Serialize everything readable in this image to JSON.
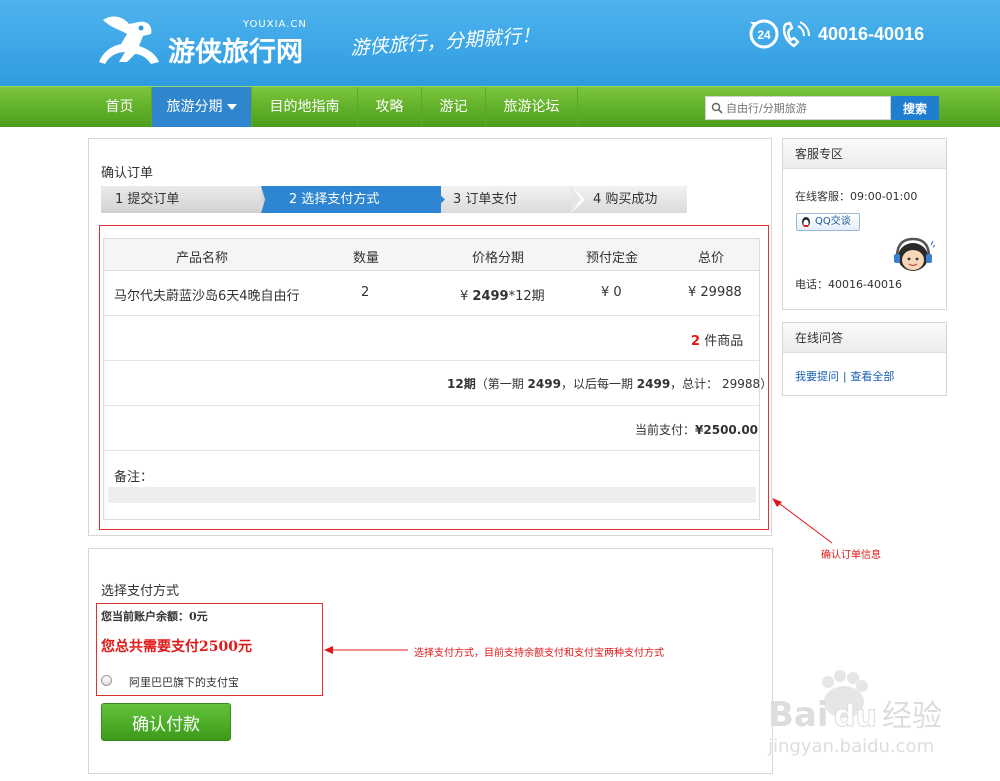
{
  "header": {
    "logo_small": "YOUXIA.CN",
    "logo_main": "游侠旅行网",
    "slogan": "游侠旅行，分期就行！",
    "phone_badge": "24",
    "phone": "40016-40016"
  },
  "nav": {
    "items": [
      {
        "label": "首页"
      },
      {
        "label": "旅游分期"
      },
      {
        "label": "目的地指南"
      },
      {
        "label": "攻略"
      },
      {
        "label": "游记"
      },
      {
        "label": "旅游论坛"
      }
    ],
    "search_placeholder": "自由行/分期旅游",
    "search_button": "搜索"
  },
  "order": {
    "section_title": "确认订单",
    "steps": [
      "1 提交订单",
      "2 选择支付方式",
      "3  订单支付",
      "4  购买成功"
    ],
    "columns": [
      "产品名称",
      "数量",
      "价格分期",
      "预付定金",
      "总价"
    ],
    "row": {
      "name": "马尔代夫蔚蓝沙岛6天4晚自由行",
      "qty": "2",
      "price_prefix": "¥",
      "price": "2499",
      "price_suffix": "*12期",
      "deposit": "¥ 0",
      "total": "¥ 29988"
    },
    "item_count": "2",
    "item_count_label": "件商品",
    "installment": {
      "periods": "12期",
      "t1": "（第一期 ",
      "first": "2499",
      "t2": "，以后每一期 ",
      "each": "2499",
      "t3": "，总计：",
      "total": "29988",
      "t4": "）"
    },
    "current_pay_label": "当前支付：",
    "current_pay": "¥2500.00",
    "remark_label": "备注："
  },
  "payment": {
    "section_title": "选择支付方式",
    "balance_label": "您当前账户余额：",
    "balance": "0元",
    "total_label": "您总共需要支付2500元",
    "option": "阿里巴巴旗下的支付宝",
    "confirm": "确认付款"
  },
  "sidebar": {
    "service_title": "客服专区",
    "hours": "在线客服：09:00-01:00",
    "qq_label": "QQ交谈",
    "phone": "电话：40016-40016",
    "qa_title": "在线问答",
    "ask": "我要提问",
    "sep": "|",
    "view_all": "查看全部"
  },
  "annotations": {
    "order_info": "确认订单信息",
    "pay_method": "选择支付方式，目前支持余额支付和支付宝两种支付方式"
  },
  "watermark": {
    "text1": "Bai",
    "text2": "du",
    "text3": "经验",
    "url": "jingyan.baidu.com"
  },
  "colors": {
    "header_blue": "#2f9be0",
    "nav_green": "#5aab24",
    "active_blue": "#2e86d3",
    "accent_red": "#e01818",
    "button_green": "#4aa822"
  }
}
